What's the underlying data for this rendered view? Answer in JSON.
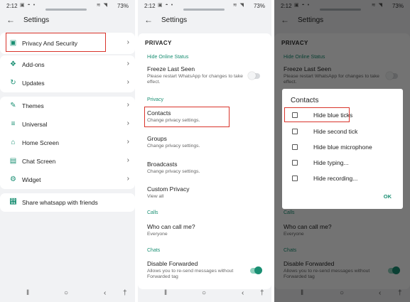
{
  "colors": {
    "accent": "#1a8f73",
    "highlight": "#d9342b",
    "background": "#f1f2f4",
    "card": "#ffffff"
  },
  "status": {
    "time": "2:12",
    "battery": "73%"
  },
  "panel1": {
    "title": "Settings",
    "group1": [
      {
        "label": "Privacy And Security",
        "icon": "lock-icon"
      }
    ],
    "group2": [
      {
        "label": "Add-ons",
        "icon": "puzzle-icon"
      },
      {
        "label": "Updates",
        "icon": "refresh-icon"
      }
    ],
    "group3": [
      {
        "label": "Themes",
        "icon": "brush-icon"
      },
      {
        "label": "Universal",
        "icon": "sliders-icon"
      },
      {
        "label": "Home Screen",
        "icon": "home-icon"
      },
      {
        "label": "Chat Screen",
        "icon": "chat-icon"
      },
      {
        "label": "Widget",
        "icon": "gear-icon"
      }
    ],
    "share": {
      "label": "Share whatsapp with friends",
      "icon": "share-icon"
    }
  },
  "panel2": {
    "title": "Settings",
    "header": "PRIVACY",
    "sec_hide_online": "Hide Online Status",
    "freeze_title": "Freeze Last Seen",
    "freeze_sub": "Please restart WhatsApp for changes to take effect.",
    "freeze_toggle": false,
    "sec_privacy": "Privacy",
    "contacts_title": "Contacts",
    "contacts_sub": "Change privacy settings.",
    "groups_title": "Groups",
    "groups_sub": "Change privacy settings.",
    "broadcasts_title": "Broadcasts",
    "broadcasts_sub": "Change privacy settings.",
    "custom_title": "Custom Privacy",
    "custom_sub": "View all",
    "sec_calls": "Calls",
    "who_call_title": "Who can call me?",
    "who_call_sub": "Everyone",
    "sec_chats": "Chats",
    "fwd_title": "Disable Forwarded",
    "fwd_sub": "Allows you to re-send messages without Forwarded tag",
    "fwd_toggle": true
  },
  "panel3": {
    "dialog_title": "Contacts",
    "options": [
      "Hide blue ticks",
      "Hide second tick",
      "Hide blue microphone",
      "Hide typing...",
      "Hide recording..."
    ],
    "ok": "OK"
  }
}
